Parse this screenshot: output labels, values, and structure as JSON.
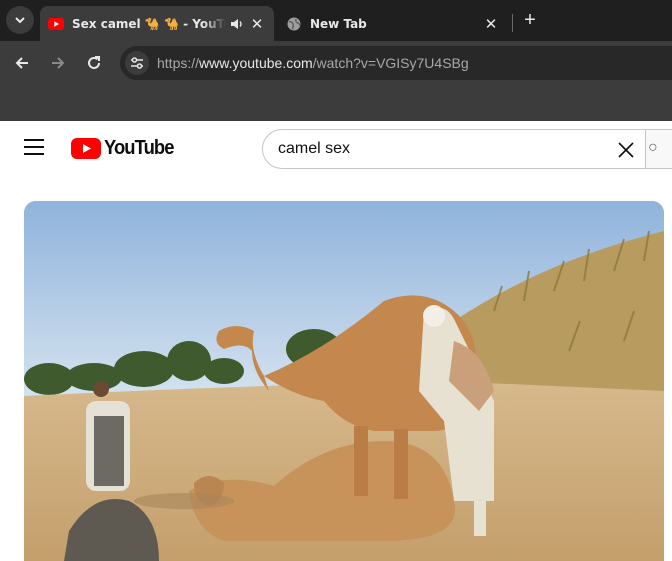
{
  "browser": {
    "active_tab": {
      "title": "Sex camel 🐪 🐪 - YouTube",
      "favicon": "youtube-favicon",
      "audio": "speaker-icon"
    },
    "inactive_tab": {
      "title": "New Tab",
      "favicon": "globe-icon"
    },
    "new_tab_label": "+",
    "close_glyph": "✕",
    "url_prefix": "https://",
    "url_host": "www.youtube.com",
    "url_path": "/watch?v=VGISy7U4SBg"
  },
  "youtube": {
    "logo_text": "YouTube",
    "logo_color": "#ff0000",
    "search": {
      "value": "camel sex"
    }
  },
  "video": {
    "icon": "video-frame",
    "sky_color": "#bfd3ea",
    "sand_color": "#c8a878"
  }
}
